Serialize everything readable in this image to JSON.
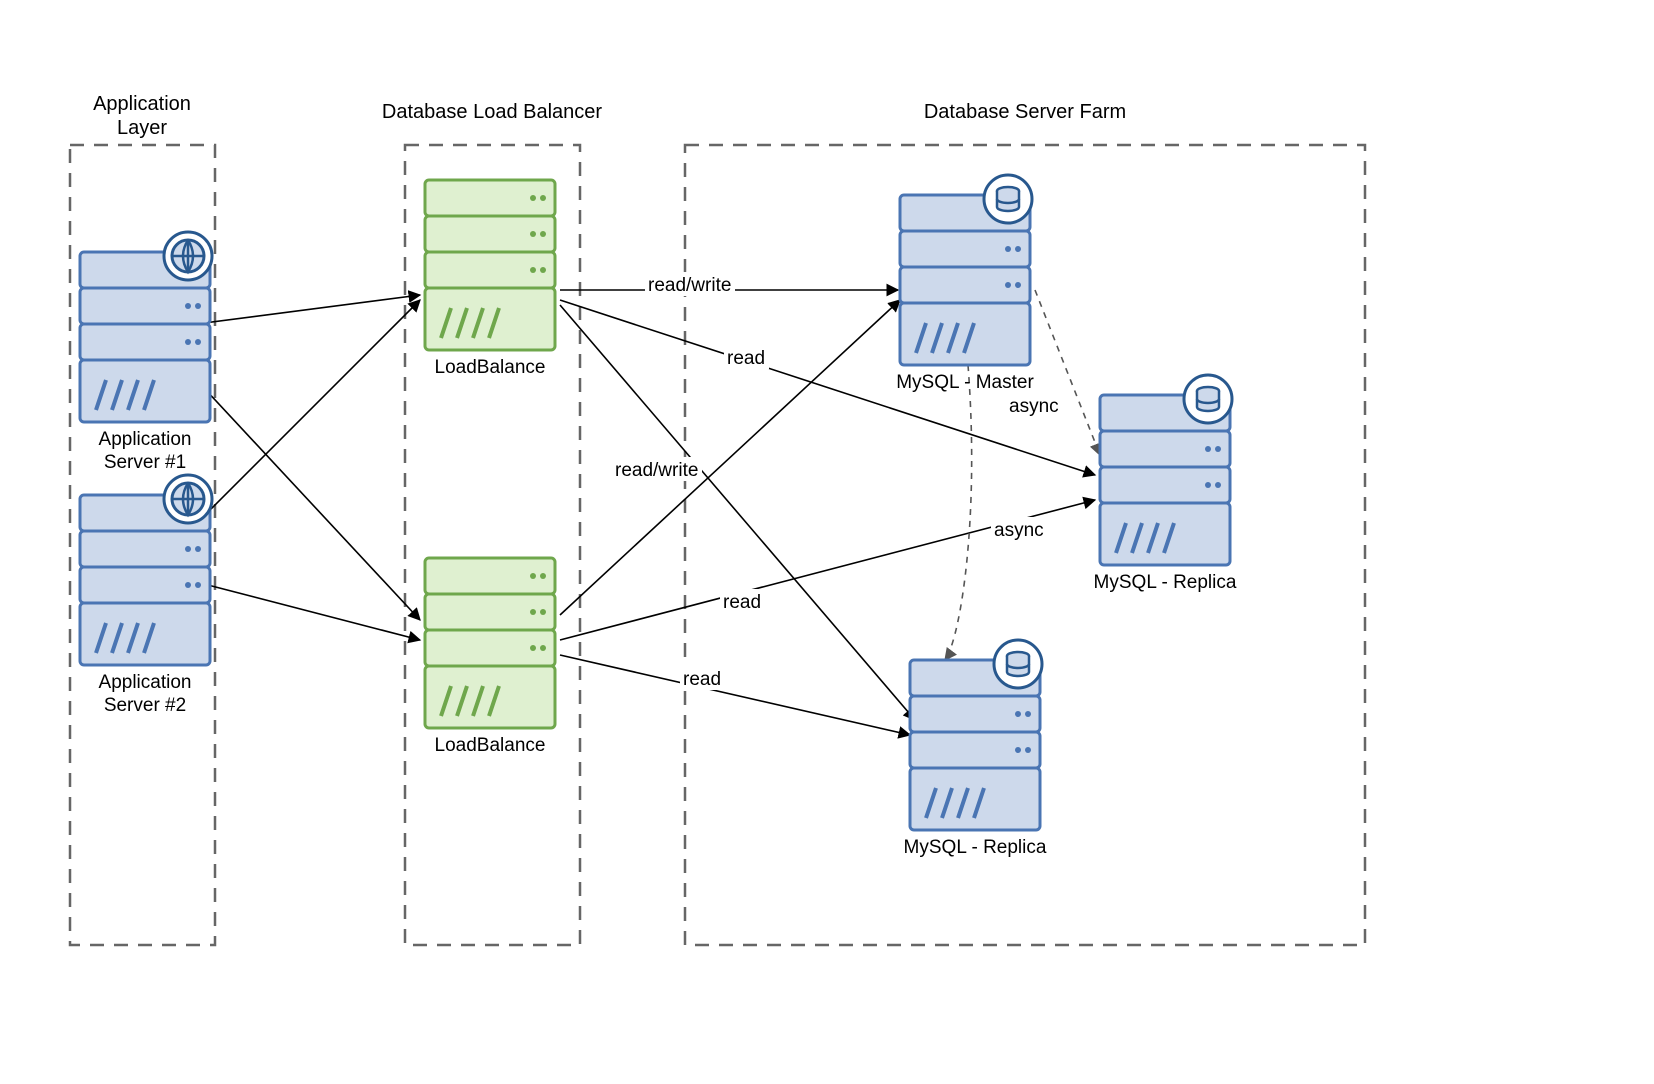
{
  "groups": {
    "app": {
      "title_l1": "Application",
      "title_l2": "Layer"
    },
    "lb": {
      "title": "Database Load Balancer"
    },
    "farm": {
      "title": "Database Server Farm"
    }
  },
  "nodes": {
    "app1": {
      "label_l1": "Application",
      "label_l2": "Server #1"
    },
    "app2": {
      "label_l1": "Application",
      "label_l2": "Server #2"
    },
    "lb1": {
      "label": "LoadBalance"
    },
    "lb2": {
      "label": "LoadBalance"
    },
    "master": {
      "label": "MySQL - Master"
    },
    "rep1": {
      "label": "MySQL - Replica"
    },
    "rep2": {
      "label": "MySQL - Replica"
    }
  },
  "edges": {
    "rw1": "read/write",
    "rw2": "read/write",
    "rd1": "read",
    "rd2": "read",
    "rd3": "read",
    "async1": "async",
    "async2": "async"
  },
  "styles": {
    "blueStroke": "#4a75b3",
    "blueFill": "#cdd9eb",
    "blueDark": "#28588e",
    "greenStroke": "#6fa74c",
    "greenFill": "#dff0d0"
  }
}
